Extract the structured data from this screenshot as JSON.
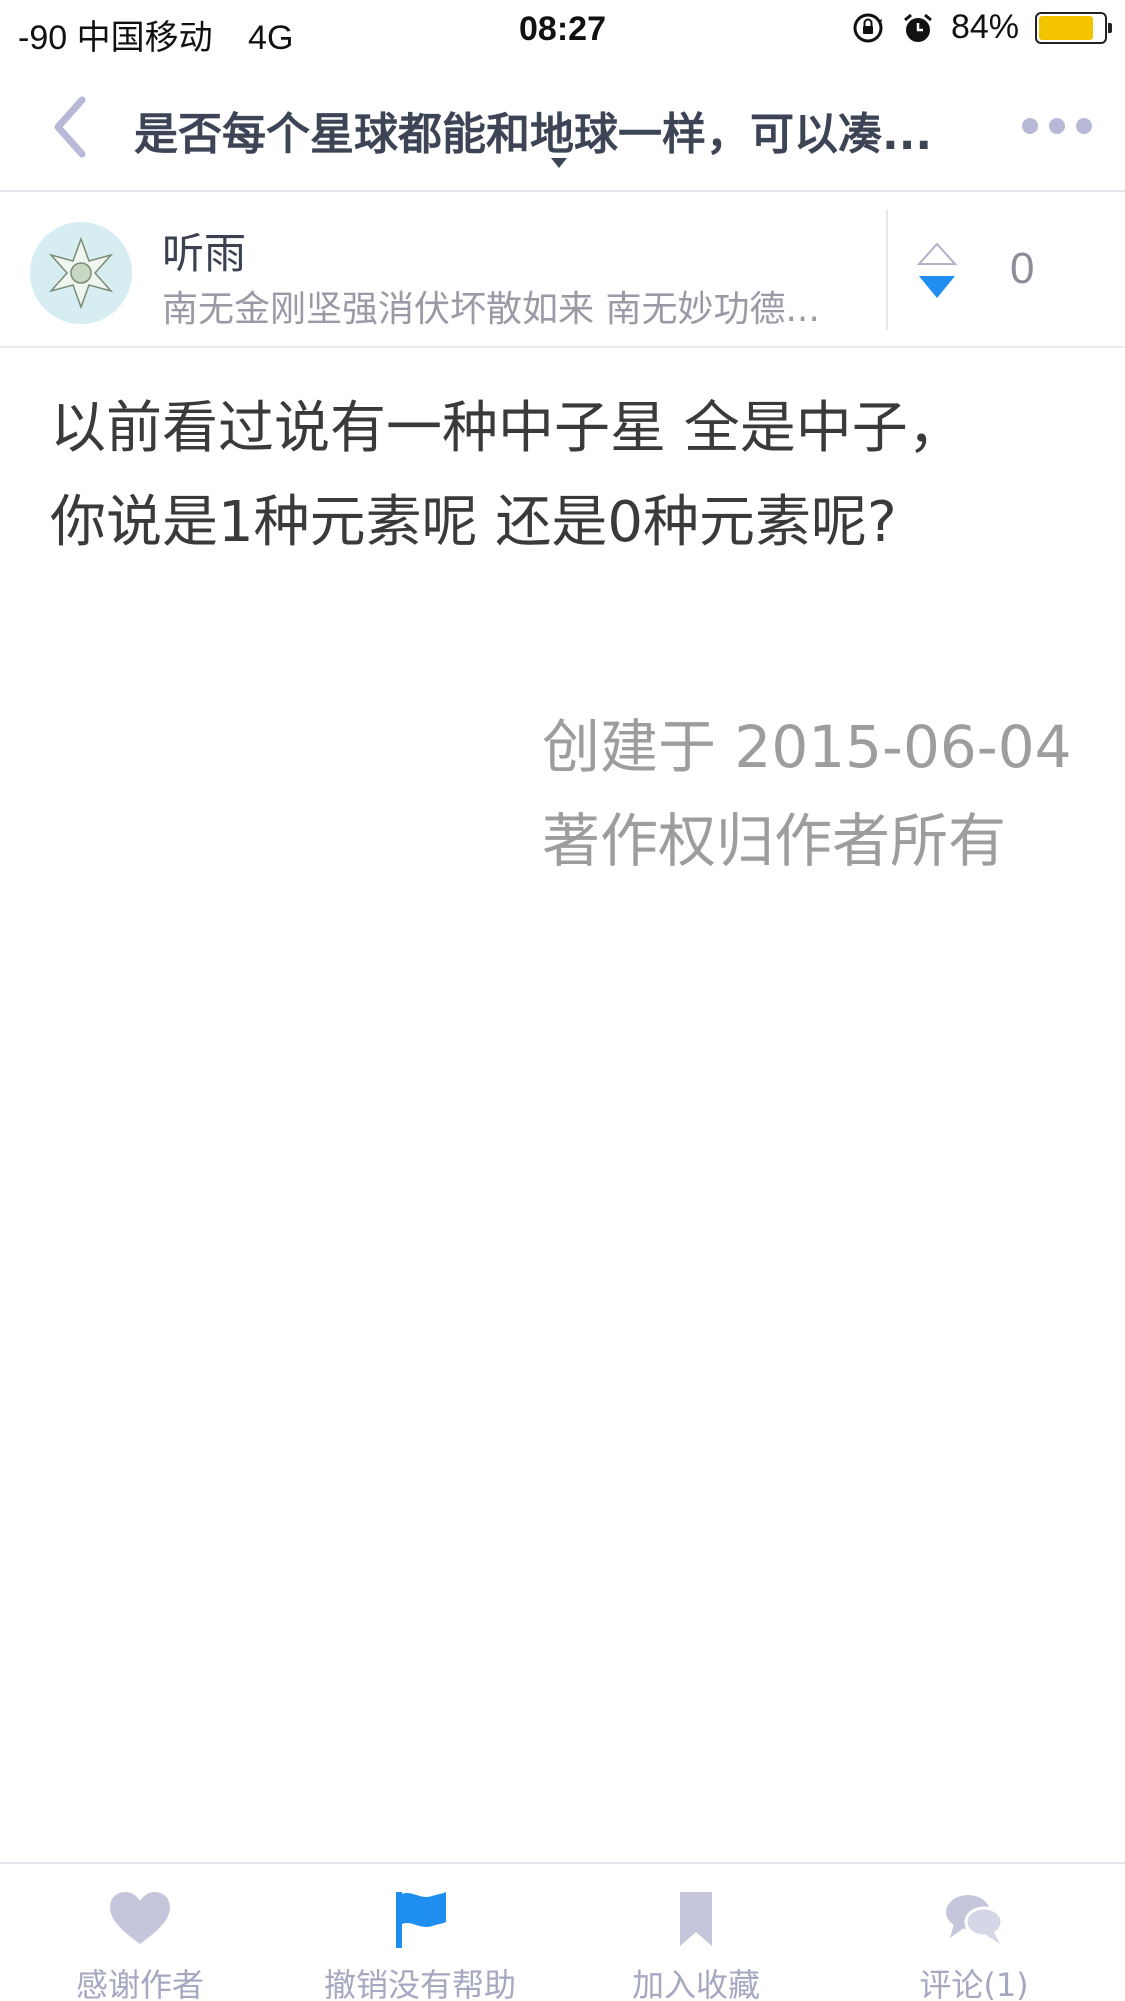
{
  "status_bar": {
    "signal": "-90",
    "carrier": "中国移动",
    "network": "4G",
    "time": "08:27",
    "battery_percent": "84%",
    "battery_level": 0.84,
    "battery_color": "#f5c400",
    "icons": [
      "rotation-lock-icon",
      "alarm-icon",
      "battery-icon"
    ]
  },
  "nav": {
    "title": "是否每个星球都能和地球一样，可以凑...",
    "back_icon": "chevron-left-icon",
    "more_icon": "more-dots-icon",
    "accent": "#b7b9d6"
  },
  "author": {
    "name": "听雨",
    "signature": "南无金刚坚强消伏坏散如来 南无妙功德...",
    "vote_count": "0",
    "vote_icon": "vote-up-down-icon",
    "vote_down_color": "#1e8ef0"
  },
  "answer": {
    "lines": [
      "以前看过说有一种中子星 全是中子，",
      "你说是1种元素呢 还是0种元素呢?"
    ],
    "created": "创建于 2015-06-04",
    "copyright": "著作权归作者所有"
  },
  "tabbar": {
    "items": [
      {
        "label": "感谢作者",
        "icon": "heart-icon"
      },
      {
        "label": "撤销没有帮助",
        "icon": "flag-icon",
        "active": true,
        "color": "#1e8ef0"
      },
      {
        "label": "加入收藏",
        "icon": "bookmark-icon"
      },
      {
        "label": "评论(1)",
        "icon": "comment-bubbles-icon"
      }
    ],
    "inactive_color": "#c5c6dc"
  }
}
